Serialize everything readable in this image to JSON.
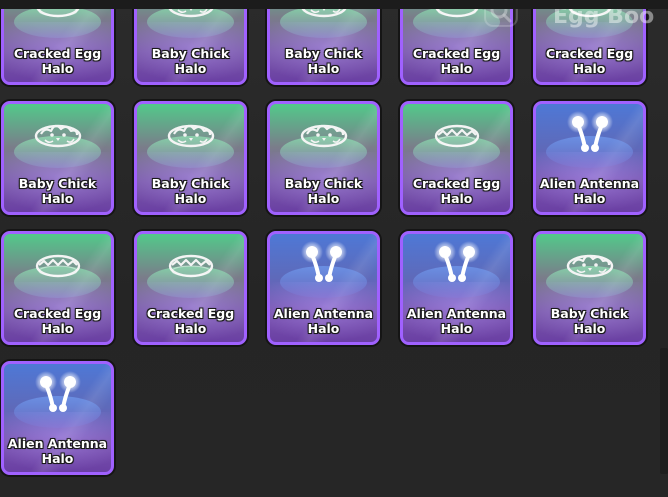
{
  "header": {
    "partial_title": "Egg Boo"
  },
  "inventory": {
    "items": [
      {
        "name": "Cracked Egg Halo",
        "kind": "cracked-egg",
        "rarity_color": "green"
      },
      {
        "name": "Baby Chick Halo",
        "kind": "baby-chick",
        "rarity_color": "green"
      },
      {
        "name": "Baby Chick Halo",
        "kind": "baby-chick",
        "rarity_color": "green"
      },
      {
        "name": "Cracked Egg Halo",
        "kind": "cracked-egg",
        "rarity_color": "green"
      },
      {
        "name": "Cracked Egg Halo",
        "kind": "cracked-egg",
        "rarity_color": "green"
      },
      {
        "name": "Baby Chick Halo",
        "kind": "baby-chick",
        "rarity_color": "green"
      },
      {
        "name": "Baby Chick Halo",
        "kind": "baby-chick",
        "rarity_color": "green"
      },
      {
        "name": "Baby Chick Halo",
        "kind": "baby-chick",
        "rarity_color": "green"
      },
      {
        "name": "Cracked Egg Halo",
        "kind": "cracked-egg",
        "rarity_color": "green"
      },
      {
        "name": "Alien Antenna Halo",
        "kind": "alien-antenna",
        "rarity_color": "blue"
      },
      {
        "name": "Cracked Egg Halo",
        "kind": "cracked-egg",
        "rarity_color": "green"
      },
      {
        "name": "Cracked Egg Halo",
        "kind": "cracked-egg",
        "rarity_color": "green"
      },
      {
        "name": "Alien Antenna Halo",
        "kind": "alien-antenna",
        "rarity_color": "blue"
      },
      {
        "name": "Alien Antenna Halo",
        "kind": "alien-antenna",
        "rarity_color": "blue"
      },
      {
        "name": "Baby Chick Halo",
        "kind": "baby-chick",
        "rarity_color": "green"
      },
      {
        "name": "Alien Antenna Halo",
        "kind": "alien-antenna",
        "rarity_color": "blue"
      }
    ]
  },
  "colors": {
    "card_border": "#a061ff",
    "green_tint": "#52c98a",
    "blue_tint": "#4e78d6",
    "background": "#262626"
  }
}
